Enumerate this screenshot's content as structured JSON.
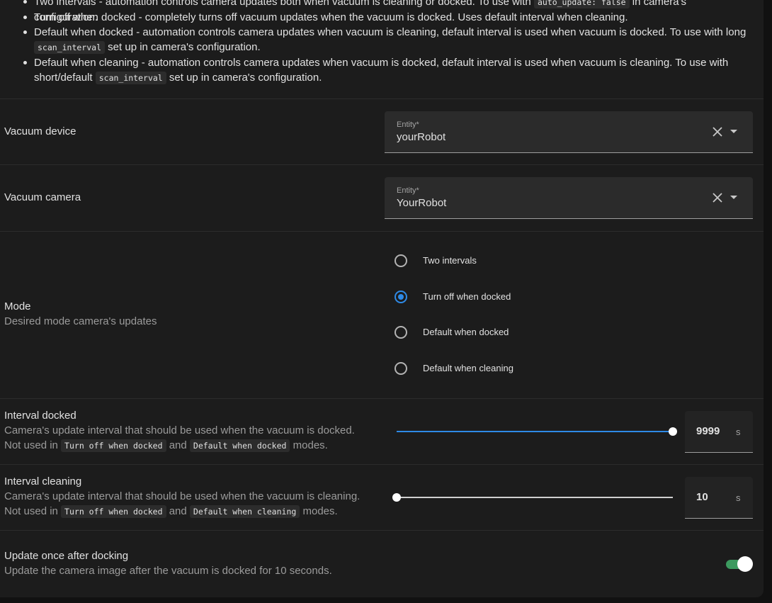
{
  "descriptions": [
    {
      "text_before": "Two intervals - automation controls camera updates both when vacuum is cleaning or docked. To use with ",
      "code": "auto_update: false",
      "text_after": " in camera's configuration."
    },
    {
      "text": "Turn off when docked - completely turns off vacuum updates when the vacuum is docked. Uses default interval when cleaning."
    },
    {
      "text_before": "Default when docked - automation controls camera updates when vacuum is cleaning, default interval is used when vacuum is docked. To use with long ",
      "code": "scan_interval",
      "text_after": " set up in camera's configuration."
    },
    {
      "text_before": "Default when cleaning - automation controls camera updates when vacuum is docked, default interval is used when vacuum is cleaning. To use with short/default ",
      "code": "scan_interval",
      "text_after": " set up in camera's configuration."
    }
  ],
  "vacuum_device": {
    "label": "Vacuum device",
    "field_label": "Entity*",
    "value": "yourRobot"
  },
  "vacuum_camera": {
    "label": "Vacuum camera",
    "field_label": "Entity*",
    "value": "YourRobot"
  },
  "mode": {
    "label": "Mode",
    "description": "Desired mode camera's updates",
    "options": [
      {
        "label": "Two intervals",
        "checked": false
      },
      {
        "label": "Turn off when docked",
        "checked": true
      },
      {
        "label": "Default when docked",
        "checked": false
      },
      {
        "label": "Default when cleaning",
        "checked": false
      }
    ]
  },
  "interval_docked": {
    "label": "Interval docked",
    "line1": "Camera's update interval that should be used when the vacuum is docked.",
    "not_used_in": "Not used in ",
    "code1": "Turn off when docked",
    "and": " and ",
    "code2": "Default when docked",
    "modes": " modes.",
    "value": "9999",
    "unit": "s",
    "slider_fraction": 1.0
  },
  "interval_cleaning": {
    "label": "Interval cleaning",
    "line1": "Camera's update interval that should be used when the vacuum is cleaning.",
    "not_used_in": "Not used in ",
    "code1": "Turn off when docked",
    "and": " and ",
    "code2": "Default when cleaning",
    "modes": " modes.",
    "value": "10",
    "unit": "s",
    "slider_fraction": 0.0
  },
  "update_once": {
    "label": "Update once after docking",
    "description": "Update the camera image after the vacuum is docked for 10 seconds.",
    "enabled": true
  },
  "colors": {
    "accent": "#2e8ae6",
    "toggle_on": "#3c9a5f",
    "background": "#1c1c1c"
  }
}
